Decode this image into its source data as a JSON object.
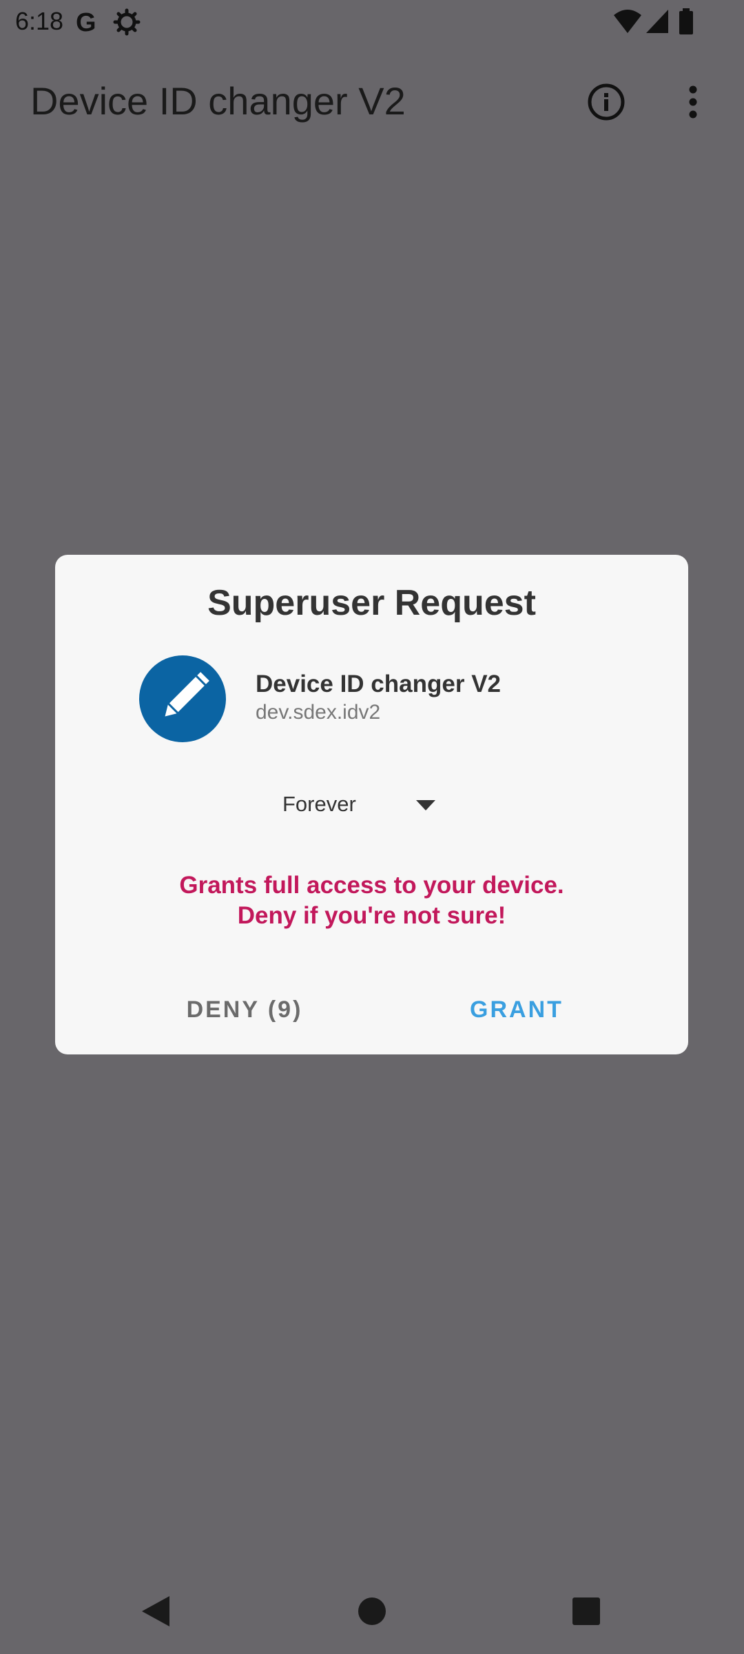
{
  "status_bar": {
    "time": "6:18",
    "icons": [
      "google-icon",
      "settings-gear-icon",
      "wifi-icon",
      "signal-icon",
      "battery-icon"
    ]
  },
  "app_bar": {
    "title": "Device ID changer V2",
    "actions": [
      "info-icon",
      "more-vertical-icon"
    ]
  },
  "dialog": {
    "title": "Superuser Request",
    "app_icon": "pencil-icon",
    "app_name": "Device ID changer V2",
    "package": "dev.sdex.idv2",
    "duration_selected": "Forever",
    "warning_line1": "Grants full access to your device.",
    "warning_line2": "Deny if you're not sure!",
    "deny_label": "DENY (9)",
    "grant_label": "GRANT"
  },
  "nav_bar": {
    "buttons": [
      "back-icon",
      "home-icon",
      "recents-icon"
    ]
  },
  "colors": {
    "scrim_background": "#68666a",
    "dialog_background": "#f7f7f7",
    "app_icon_background": "#0b64a3",
    "warning_text": "#c2185b",
    "grant_text": "#3a9fe0",
    "deny_text": "#6b6b6b"
  }
}
